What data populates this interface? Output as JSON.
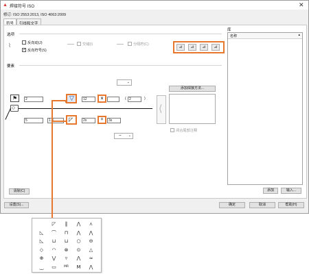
{
  "window": {
    "title": "焊接符号 ISO",
    "close_label": "✕",
    "title_icon": "autocad-icon"
  },
  "revision": "修订: ISO 2553:2013, ISO 4063:2009",
  "tabs": [
    {
      "label": "符号"
    },
    {
      "label": "引线和文字"
    }
  ],
  "options": {
    "section_label": "选项",
    "both_sides_label": "反向动(J)",
    "reverse_symbol_label": "反向符号(S)",
    "reverse_symbol_checked": true,
    "both_sides_checked": false,
    "stagger_label": "交错(I)",
    "split_label": "分隔符(C)"
  },
  "elements": {
    "section_label": "要素",
    "add_weld_method_label": "添加焊接方法...",
    "close_tail_label": "闭合尾部注释",
    "upper": {
      "left": "2",
      "size": "12",
      "count_sep": "x",
      "length": "",
      "paren_value": "2"
    },
    "lower": {
      "left": "5",
      "prefix": "1.3",
      "size": "2s",
      "sep": "=",
      "length": "3s"
    }
  },
  "library": {
    "section_label": "库",
    "column_header": "名称"
  },
  "buttons": {
    "clear": "清除(C)",
    "add": "添加",
    "import": "输入...",
    "settings": "设置(S)...",
    "ok": "确定",
    "cancel": "取消",
    "help": "帮助(H)"
  },
  "palette_symbols": [
    [
      "",
      "◸",
      "‖",
      "⋀",
      "⋏"
    ],
    [
      "◺",
      "⌒",
      "⊓",
      "⋀",
      "⋀"
    ],
    [
      "◺",
      "⊔",
      "⊔",
      "○",
      "⊖"
    ],
    [
      "◇",
      "◠",
      "⊗",
      "⊙",
      "△"
    ],
    [
      "⊕",
      "⋁",
      "▿",
      "⋀",
      "≈"
    ],
    [
      "⏝",
      "▭",
      "MR",
      "M",
      "⋀"
    ]
  ],
  "colors": {
    "highlight": "#e8772e",
    "dialog_bg": "#f0f0f0"
  }
}
